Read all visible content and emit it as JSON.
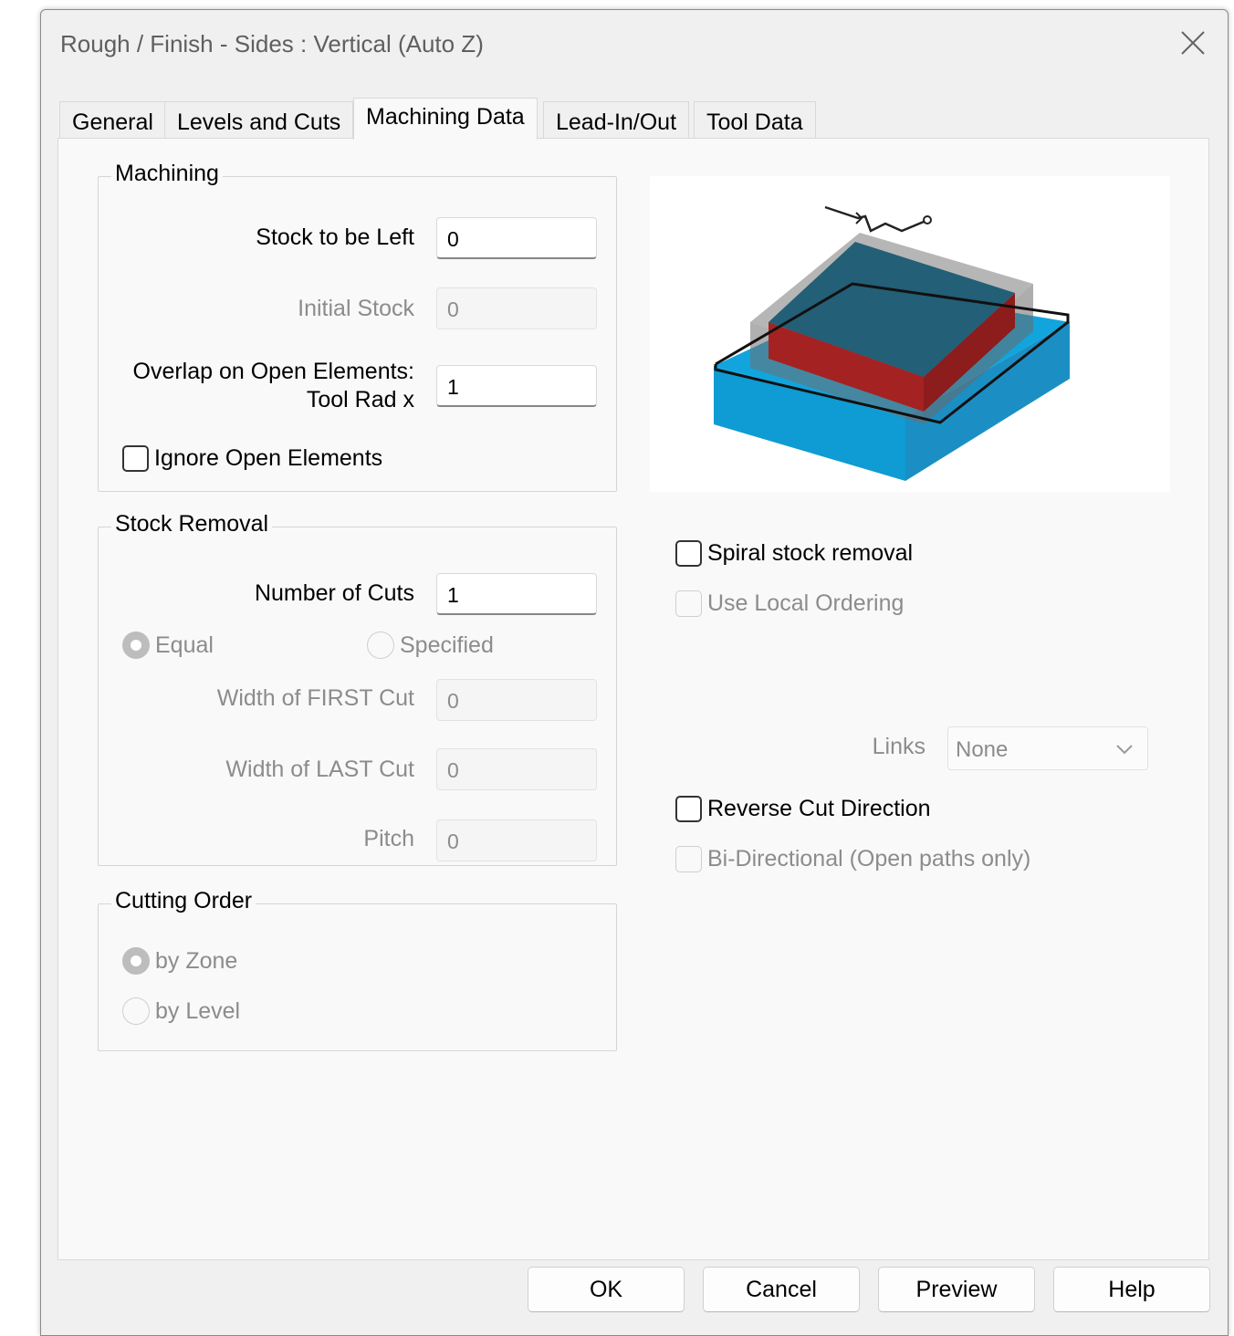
{
  "window": {
    "title": "Rough / Finish - Sides : Vertical (Auto Z)"
  },
  "tabs": [
    {
      "label": "General"
    },
    {
      "label": "Levels and Cuts"
    },
    {
      "label": "Machining Data",
      "active": true
    },
    {
      "label": "Lead-In/Out"
    },
    {
      "label": "Tool Data"
    }
  ],
  "machining": {
    "title": "Machining",
    "stock_left_label": "Stock to be Left",
    "stock_left_value": "0",
    "initial_stock_label": "Initial Stock",
    "initial_stock_value": "0",
    "overlap_label_1": "Overlap on Open Elements:",
    "overlap_label_2": "Tool Rad x",
    "overlap_value": "1",
    "ignore_open_label": "Ignore Open Elements",
    "ignore_open_checked": false
  },
  "stock_removal": {
    "title": "Stock Removal",
    "num_cuts_label": "Number of Cuts",
    "num_cuts_value": "1",
    "equal_label": "Equal",
    "specified_label": "Specified",
    "selected": "Equal",
    "first_cut_label": "Width of FIRST Cut",
    "first_cut_value": "0",
    "last_cut_label": "Width of LAST Cut",
    "last_cut_value": "0",
    "pitch_label": "Pitch",
    "pitch_value": "0"
  },
  "cutting_order": {
    "title": "Cutting Order",
    "by_zone_label": "by Zone",
    "by_level_label": "by Level",
    "selected": "by Zone"
  },
  "options": {
    "spiral_label": "Spiral stock removal",
    "local_ordering_label": "Use Local Ordering",
    "links_label": "Links",
    "links_value": "None",
    "reverse_label": "Reverse Cut Direction",
    "bidirectional_label": "Bi-Directional (Open paths only)"
  },
  "buttons": {
    "ok": "OK",
    "cancel": "Cancel",
    "preview": "Preview",
    "help": "Help"
  },
  "colors": {
    "stock_top": "#235f76",
    "stock_side_red": "#a52222",
    "base_blue": "#12a4dc",
    "base_blue_side": "#1b93c8"
  },
  "icons": {
    "close": "close-icon",
    "chevron": "chevron-down-icon"
  }
}
